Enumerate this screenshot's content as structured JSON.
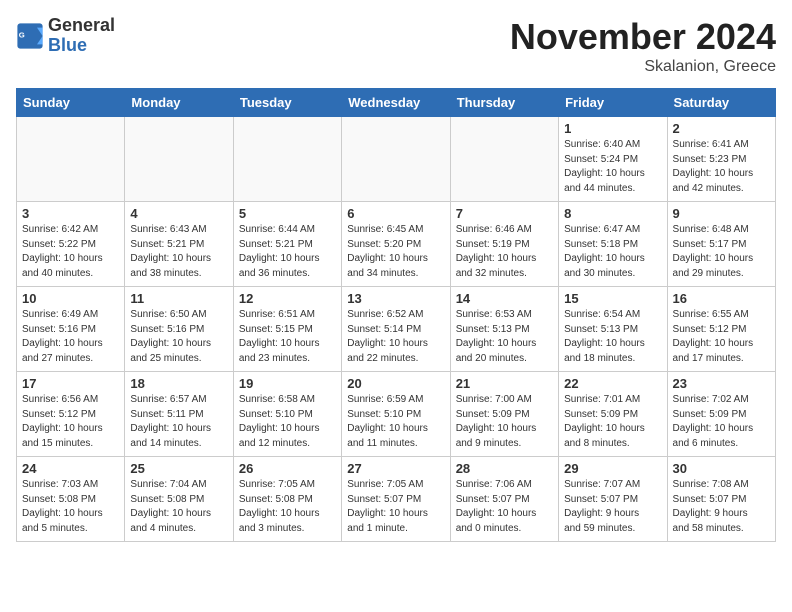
{
  "header": {
    "logo_line1": "General",
    "logo_line2": "Blue",
    "month_title": "November 2024",
    "subtitle": "Skalanion, Greece"
  },
  "days_of_week": [
    "Sunday",
    "Monday",
    "Tuesday",
    "Wednesday",
    "Thursday",
    "Friday",
    "Saturday"
  ],
  "weeks": [
    [
      {
        "day": "",
        "info": ""
      },
      {
        "day": "",
        "info": ""
      },
      {
        "day": "",
        "info": ""
      },
      {
        "day": "",
        "info": ""
      },
      {
        "day": "",
        "info": ""
      },
      {
        "day": "1",
        "info": "Sunrise: 6:40 AM\nSunset: 5:24 PM\nDaylight: 10 hours\nand 44 minutes."
      },
      {
        "day": "2",
        "info": "Sunrise: 6:41 AM\nSunset: 5:23 PM\nDaylight: 10 hours\nand 42 minutes."
      }
    ],
    [
      {
        "day": "3",
        "info": "Sunrise: 6:42 AM\nSunset: 5:22 PM\nDaylight: 10 hours\nand 40 minutes."
      },
      {
        "day": "4",
        "info": "Sunrise: 6:43 AM\nSunset: 5:21 PM\nDaylight: 10 hours\nand 38 minutes."
      },
      {
        "day": "5",
        "info": "Sunrise: 6:44 AM\nSunset: 5:21 PM\nDaylight: 10 hours\nand 36 minutes."
      },
      {
        "day": "6",
        "info": "Sunrise: 6:45 AM\nSunset: 5:20 PM\nDaylight: 10 hours\nand 34 minutes."
      },
      {
        "day": "7",
        "info": "Sunrise: 6:46 AM\nSunset: 5:19 PM\nDaylight: 10 hours\nand 32 minutes."
      },
      {
        "day": "8",
        "info": "Sunrise: 6:47 AM\nSunset: 5:18 PM\nDaylight: 10 hours\nand 30 minutes."
      },
      {
        "day": "9",
        "info": "Sunrise: 6:48 AM\nSunset: 5:17 PM\nDaylight: 10 hours\nand 29 minutes."
      }
    ],
    [
      {
        "day": "10",
        "info": "Sunrise: 6:49 AM\nSunset: 5:16 PM\nDaylight: 10 hours\nand 27 minutes."
      },
      {
        "day": "11",
        "info": "Sunrise: 6:50 AM\nSunset: 5:16 PM\nDaylight: 10 hours\nand 25 minutes."
      },
      {
        "day": "12",
        "info": "Sunrise: 6:51 AM\nSunset: 5:15 PM\nDaylight: 10 hours\nand 23 minutes."
      },
      {
        "day": "13",
        "info": "Sunrise: 6:52 AM\nSunset: 5:14 PM\nDaylight: 10 hours\nand 22 minutes."
      },
      {
        "day": "14",
        "info": "Sunrise: 6:53 AM\nSunset: 5:13 PM\nDaylight: 10 hours\nand 20 minutes."
      },
      {
        "day": "15",
        "info": "Sunrise: 6:54 AM\nSunset: 5:13 PM\nDaylight: 10 hours\nand 18 minutes."
      },
      {
        "day": "16",
        "info": "Sunrise: 6:55 AM\nSunset: 5:12 PM\nDaylight: 10 hours\nand 17 minutes."
      }
    ],
    [
      {
        "day": "17",
        "info": "Sunrise: 6:56 AM\nSunset: 5:12 PM\nDaylight: 10 hours\nand 15 minutes."
      },
      {
        "day": "18",
        "info": "Sunrise: 6:57 AM\nSunset: 5:11 PM\nDaylight: 10 hours\nand 14 minutes."
      },
      {
        "day": "19",
        "info": "Sunrise: 6:58 AM\nSunset: 5:10 PM\nDaylight: 10 hours\nand 12 minutes."
      },
      {
        "day": "20",
        "info": "Sunrise: 6:59 AM\nSunset: 5:10 PM\nDaylight: 10 hours\nand 11 minutes."
      },
      {
        "day": "21",
        "info": "Sunrise: 7:00 AM\nSunset: 5:09 PM\nDaylight: 10 hours\nand 9 minutes."
      },
      {
        "day": "22",
        "info": "Sunrise: 7:01 AM\nSunset: 5:09 PM\nDaylight: 10 hours\nand 8 minutes."
      },
      {
        "day": "23",
        "info": "Sunrise: 7:02 AM\nSunset: 5:09 PM\nDaylight: 10 hours\nand 6 minutes."
      }
    ],
    [
      {
        "day": "24",
        "info": "Sunrise: 7:03 AM\nSunset: 5:08 PM\nDaylight: 10 hours\nand 5 minutes."
      },
      {
        "day": "25",
        "info": "Sunrise: 7:04 AM\nSunset: 5:08 PM\nDaylight: 10 hours\nand 4 minutes."
      },
      {
        "day": "26",
        "info": "Sunrise: 7:05 AM\nSunset: 5:08 PM\nDaylight: 10 hours\nand 3 minutes."
      },
      {
        "day": "27",
        "info": "Sunrise: 7:05 AM\nSunset: 5:07 PM\nDaylight: 10 hours\nand 1 minute."
      },
      {
        "day": "28",
        "info": "Sunrise: 7:06 AM\nSunset: 5:07 PM\nDaylight: 10 hours\nand 0 minutes."
      },
      {
        "day": "29",
        "info": "Sunrise: 7:07 AM\nSunset: 5:07 PM\nDaylight: 9 hours\nand 59 minutes."
      },
      {
        "day": "30",
        "info": "Sunrise: 7:08 AM\nSunset: 5:07 PM\nDaylight: 9 hours\nand 58 minutes."
      }
    ]
  ]
}
